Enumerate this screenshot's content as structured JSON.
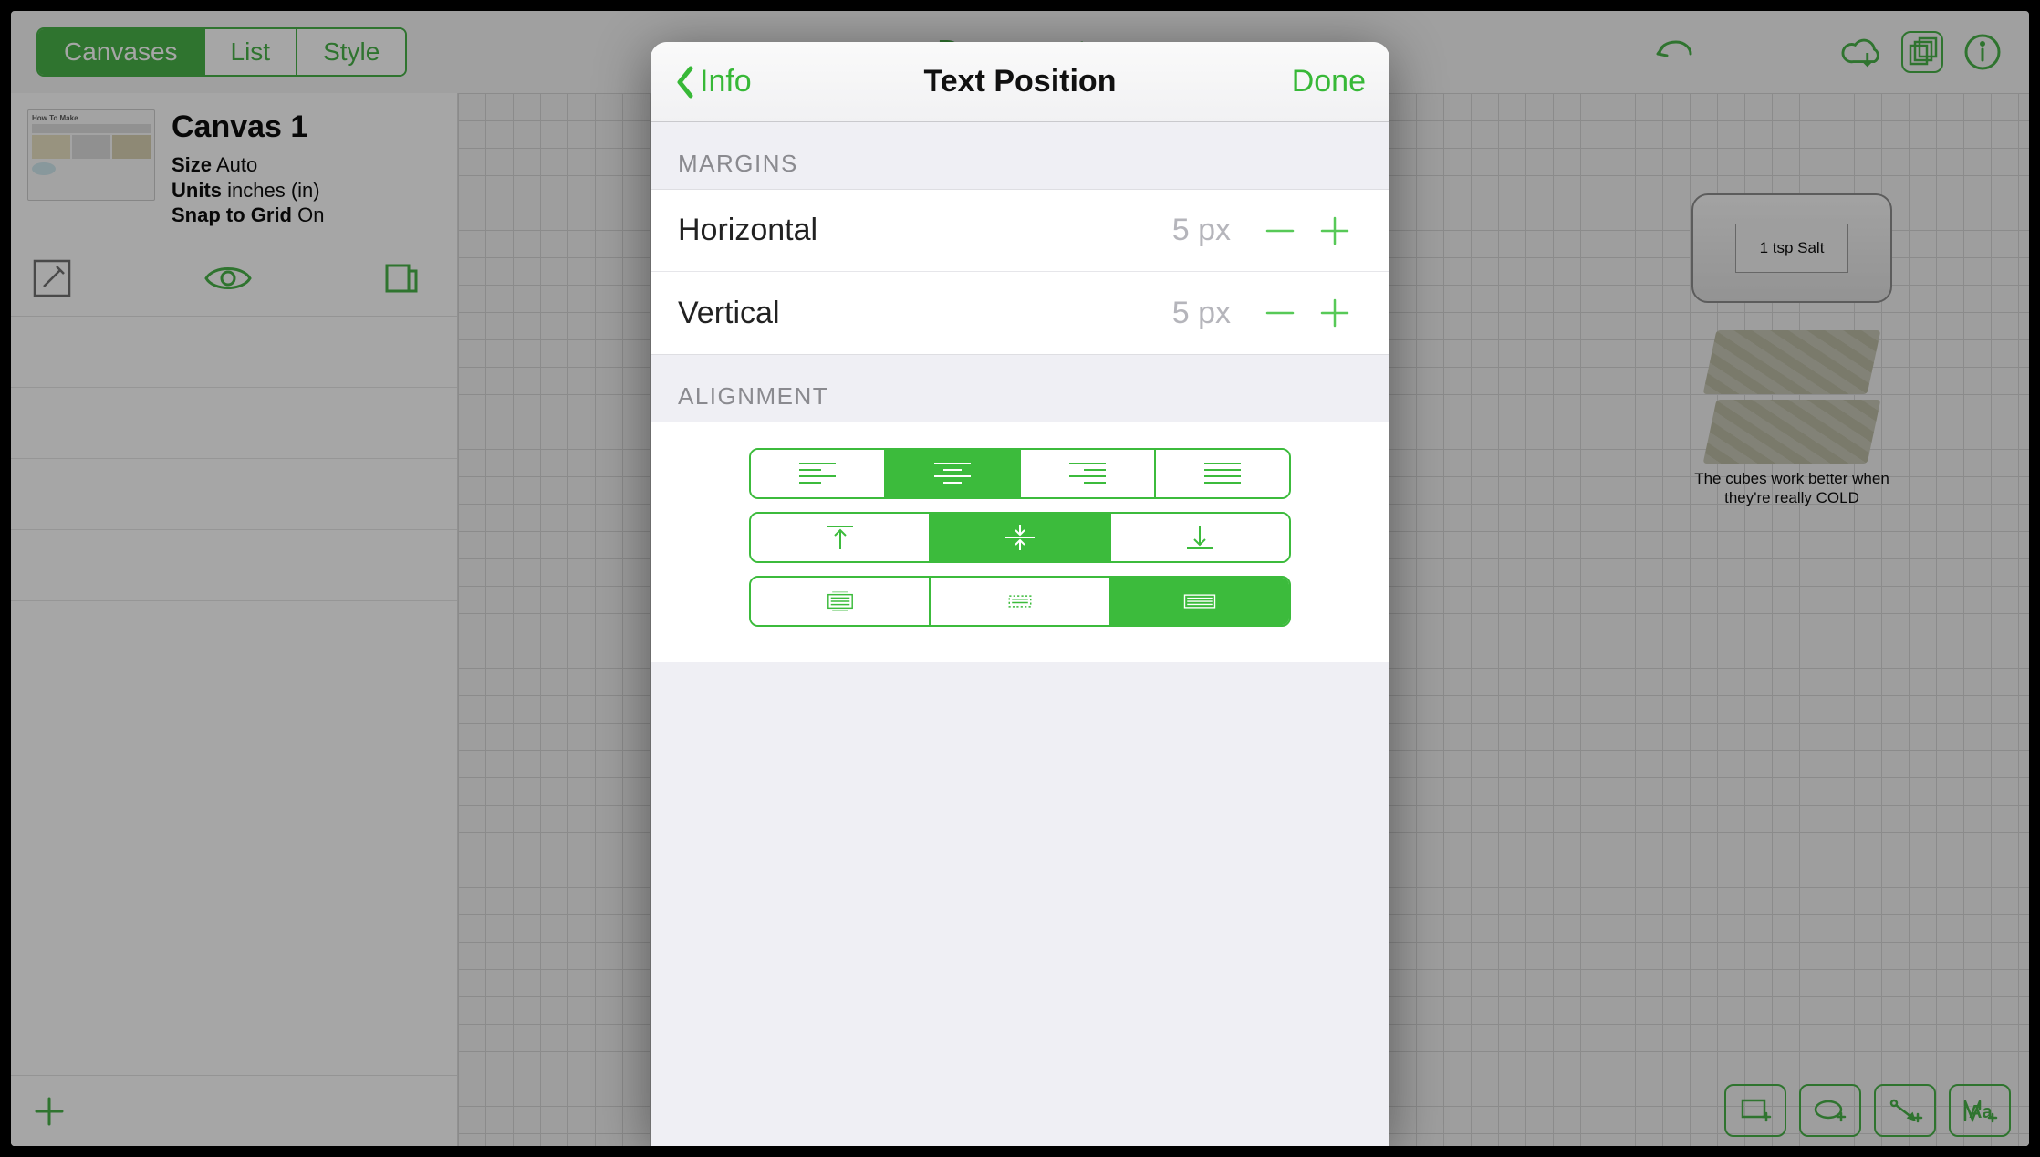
{
  "app": {
    "title": "Documents",
    "tabs": {
      "canvases": "Canvases",
      "list": "List",
      "style": "Style"
    }
  },
  "sidebar": {
    "canvas": {
      "name": "Canvas 1",
      "size_label": "Size",
      "size_value": "Auto",
      "units_label": "Units",
      "units_value": "inches (in)",
      "snap_label": "Snap to Grid",
      "snap_value": "On"
    }
  },
  "canvas_objects": {
    "salt_box": "1 tsp Salt",
    "cubes_caption": "The cubes work better when they're really COLD"
  },
  "popover": {
    "back_label": "Info",
    "title": "Text Position",
    "done": "Done",
    "sections": {
      "margins": "MARGINS",
      "alignment": "ALIGNMENT"
    },
    "margins": {
      "horizontal_label": "Horizontal",
      "horizontal_value": "5 px",
      "vertical_label": "Vertical",
      "vertical_value": "5 px"
    },
    "alignment": {
      "h_options": [
        "left",
        "center",
        "right",
        "justify"
      ],
      "h_active": "center",
      "v_options": [
        "top",
        "middle",
        "bottom"
      ],
      "v_active": "middle",
      "wrap_options": [
        "wrap-clip",
        "wrap-fit",
        "wrap-overflow"
      ],
      "wrap_active": "wrap-overflow"
    }
  },
  "colors": {
    "accent": "#3cbb3c"
  }
}
